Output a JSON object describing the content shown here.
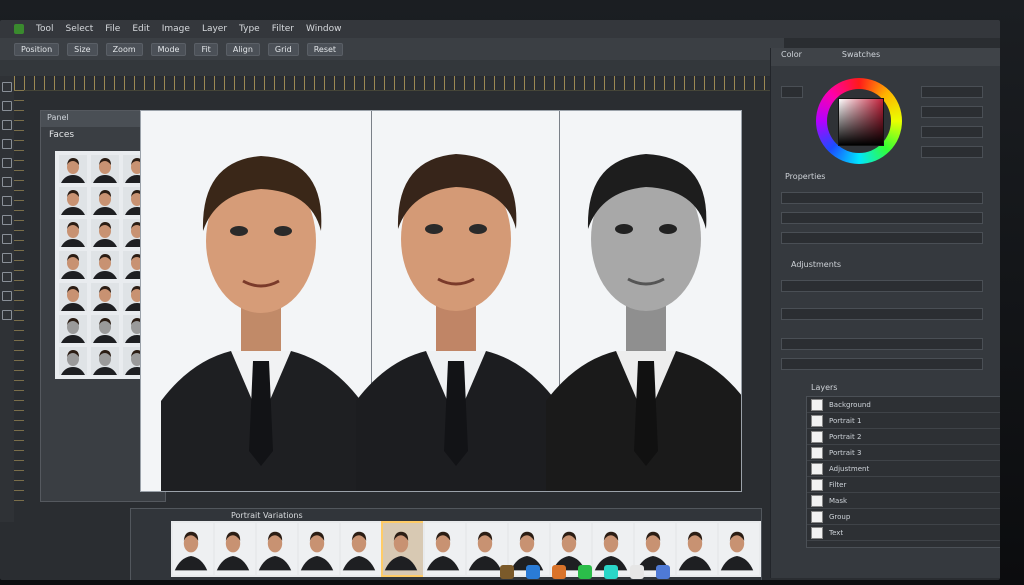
{
  "menubar": {
    "items": [
      "Tool",
      "Select",
      "File",
      "Edit",
      "Image",
      "Layer",
      "Type",
      "Filter",
      "Window"
    ]
  },
  "options": {
    "buttons": [
      "Position",
      "Size",
      "Zoom",
      "Mode",
      "Fit",
      "Align",
      "Grid",
      "Reset"
    ]
  },
  "left_panel": {
    "header": "Panel",
    "subheader": "Faces"
  },
  "filmstrip": {
    "header": "Portrait Variations",
    "selected_index": 5
  },
  "right_panel": {
    "tab_1": "Color",
    "tab_2": "Swatches",
    "label_properties": "Properties",
    "label_adjust": "Adjustments",
    "label_layers": "Layers"
  },
  "layers": [
    "Background",
    "Portrait 1",
    "Portrait 2",
    "Portrait 3",
    "Adjustment",
    "Filter",
    "Mask",
    "Group",
    "Text"
  ],
  "colors": {
    "accent": "#ffcc66",
    "brand": "#3a8a2e"
  }
}
